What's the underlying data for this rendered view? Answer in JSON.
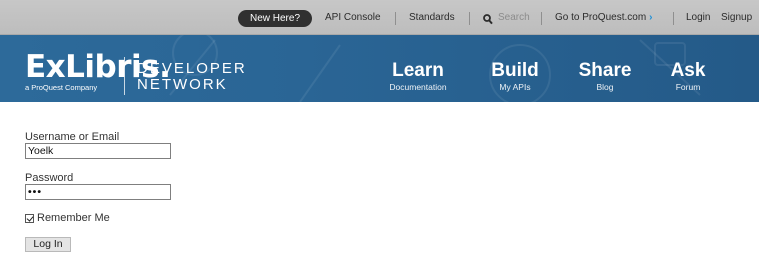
{
  "topbar": {
    "new_here": "New Here?",
    "api_console": "API Console",
    "standards": "Standards",
    "search_placeholder": "Search",
    "goto": "Go to ProQuest.com",
    "goto_chevron": "›",
    "login": "Login",
    "signup": "Signup"
  },
  "header": {
    "logo_text": "ExLibris.",
    "logo_sub": "a ProQuest Company",
    "dev_line1": "DEVELOPER",
    "dev_line2": "NETWORK",
    "nav": [
      {
        "label": "Learn",
        "sub": "Documentation"
      },
      {
        "label": "Build",
        "sub": "My APIs"
      },
      {
        "label": "Share",
        "sub": "Blog"
      },
      {
        "label": "Ask",
        "sub": "Forum"
      }
    ]
  },
  "form": {
    "username_label": "Username or Email",
    "username_value": "Yoelk",
    "password_label": "Password",
    "password_value": "•••",
    "remember_label": "Remember Me",
    "login_button": "Log In"
  },
  "colors": {
    "banner": "#2a6595",
    "topbar": "#c3c3c3",
    "accent": "#1e8fd6"
  }
}
